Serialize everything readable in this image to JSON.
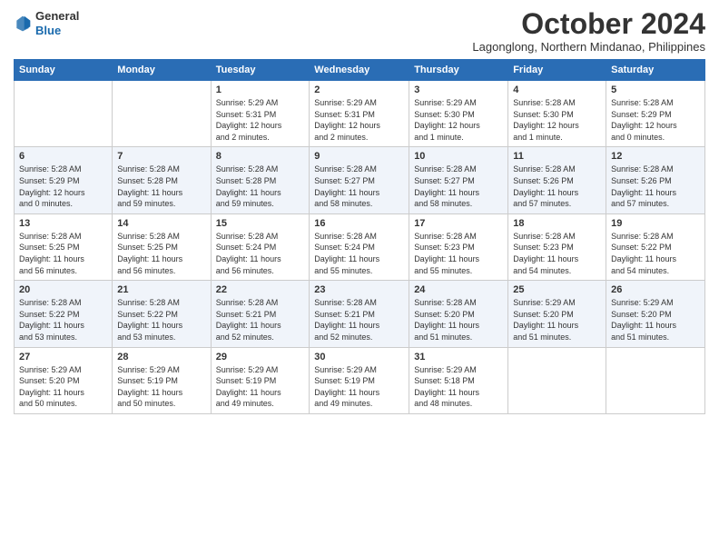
{
  "logo": {
    "line1": "General",
    "line2": "Blue"
  },
  "header": {
    "month": "October 2024",
    "location": "Lagonglong, Northern Mindanao, Philippines"
  },
  "days_of_week": [
    "Sunday",
    "Monday",
    "Tuesday",
    "Wednesday",
    "Thursday",
    "Friday",
    "Saturday"
  ],
  "weeks": [
    [
      {
        "day": "",
        "detail": ""
      },
      {
        "day": "",
        "detail": ""
      },
      {
        "day": "1",
        "detail": "Sunrise: 5:29 AM\nSunset: 5:31 PM\nDaylight: 12 hours\nand 2 minutes."
      },
      {
        "day": "2",
        "detail": "Sunrise: 5:29 AM\nSunset: 5:31 PM\nDaylight: 12 hours\nand 2 minutes."
      },
      {
        "day": "3",
        "detail": "Sunrise: 5:29 AM\nSunset: 5:30 PM\nDaylight: 12 hours\nand 1 minute."
      },
      {
        "day": "4",
        "detail": "Sunrise: 5:28 AM\nSunset: 5:30 PM\nDaylight: 12 hours\nand 1 minute."
      },
      {
        "day": "5",
        "detail": "Sunrise: 5:28 AM\nSunset: 5:29 PM\nDaylight: 12 hours\nand 0 minutes."
      }
    ],
    [
      {
        "day": "6",
        "detail": "Sunrise: 5:28 AM\nSunset: 5:29 PM\nDaylight: 12 hours\nand 0 minutes."
      },
      {
        "day": "7",
        "detail": "Sunrise: 5:28 AM\nSunset: 5:28 PM\nDaylight: 11 hours\nand 59 minutes."
      },
      {
        "day": "8",
        "detail": "Sunrise: 5:28 AM\nSunset: 5:28 PM\nDaylight: 11 hours\nand 59 minutes."
      },
      {
        "day": "9",
        "detail": "Sunrise: 5:28 AM\nSunset: 5:27 PM\nDaylight: 11 hours\nand 58 minutes."
      },
      {
        "day": "10",
        "detail": "Sunrise: 5:28 AM\nSunset: 5:27 PM\nDaylight: 11 hours\nand 58 minutes."
      },
      {
        "day": "11",
        "detail": "Sunrise: 5:28 AM\nSunset: 5:26 PM\nDaylight: 11 hours\nand 57 minutes."
      },
      {
        "day": "12",
        "detail": "Sunrise: 5:28 AM\nSunset: 5:26 PM\nDaylight: 11 hours\nand 57 minutes."
      }
    ],
    [
      {
        "day": "13",
        "detail": "Sunrise: 5:28 AM\nSunset: 5:25 PM\nDaylight: 11 hours\nand 56 minutes."
      },
      {
        "day": "14",
        "detail": "Sunrise: 5:28 AM\nSunset: 5:25 PM\nDaylight: 11 hours\nand 56 minutes."
      },
      {
        "day": "15",
        "detail": "Sunrise: 5:28 AM\nSunset: 5:24 PM\nDaylight: 11 hours\nand 56 minutes."
      },
      {
        "day": "16",
        "detail": "Sunrise: 5:28 AM\nSunset: 5:24 PM\nDaylight: 11 hours\nand 55 minutes."
      },
      {
        "day": "17",
        "detail": "Sunrise: 5:28 AM\nSunset: 5:23 PM\nDaylight: 11 hours\nand 55 minutes."
      },
      {
        "day": "18",
        "detail": "Sunrise: 5:28 AM\nSunset: 5:23 PM\nDaylight: 11 hours\nand 54 minutes."
      },
      {
        "day": "19",
        "detail": "Sunrise: 5:28 AM\nSunset: 5:22 PM\nDaylight: 11 hours\nand 54 minutes."
      }
    ],
    [
      {
        "day": "20",
        "detail": "Sunrise: 5:28 AM\nSunset: 5:22 PM\nDaylight: 11 hours\nand 53 minutes."
      },
      {
        "day": "21",
        "detail": "Sunrise: 5:28 AM\nSunset: 5:22 PM\nDaylight: 11 hours\nand 53 minutes."
      },
      {
        "day": "22",
        "detail": "Sunrise: 5:28 AM\nSunset: 5:21 PM\nDaylight: 11 hours\nand 52 minutes."
      },
      {
        "day": "23",
        "detail": "Sunrise: 5:28 AM\nSunset: 5:21 PM\nDaylight: 11 hours\nand 52 minutes."
      },
      {
        "day": "24",
        "detail": "Sunrise: 5:28 AM\nSunset: 5:20 PM\nDaylight: 11 hours\nand 51 minutes."
      },
      {
        "day": "25",
        "detail": "Sunrise: 5:29 AM\nSunset: 5:20 PM\nDaylight: 11 hours\nand 51 minutes."
      },
      {
        "day": "26",
        "detail": "Sunrise: 5:29 AM\nSunset: 5:20 PM\nDaylight: 11 hours\nand 51 minutes."
      }
    ],
    [
      {
        "day": "27",
        "detail": "Sunrise: 5:29 AM\nSunset: 5:20 PM\nDaylight: 11 hours\nand 50 minutes."
      },
      {
        "day": "28",
        "detail": "Sunrise: 5:29 AM\nSunset: 5:19 PM\nDaylight: 11 hours\nand 50 minutes."
      },
      {
        "day": "29",
        "detail": "Sunrise: 5:29 AM\nSunset: 5:19 PM\nDaylight: 11 hours\nand 49 minutes."
      },
      {
        "day": "30",
        "detail": "Sunrise: 5:29 AM\nSunset: 5:19 PM\nDaylight: 11 hours\nand 49 minutes."
      },
      {
        "day": "31",
        "detail": "Sunrise: 5:29 AM\nSunset: 5:18 PM\nDaylight: 11 hours\nand 48 minutes."
      },
      {
        "day": "",
        "detail": ""
      },
      {
        "day": "",
        "detail": ""
      }
    ]
  ]
}
